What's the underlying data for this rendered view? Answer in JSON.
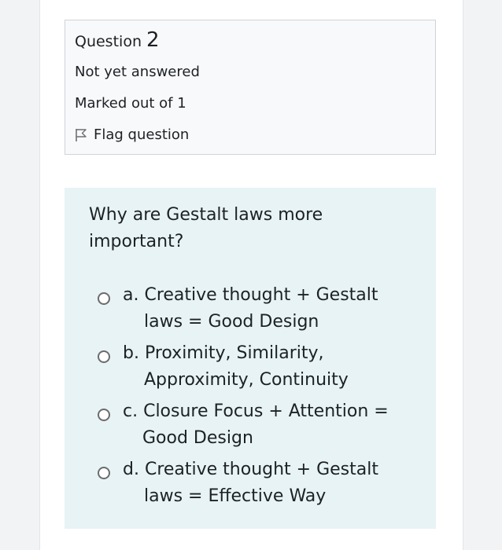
{
  "question_info": {
    "label": "Question",
    "number": "2",
    "state": "Not yet answered",
    "grade": "Marked out of 1",
    "flag_label": "Flag question"
  },
  "question": {
    "text": "Why are Gestalt laws more important?",
    "options": [
      {
        "line1": "a. Creative thought + Gestalt",
        "line2": "laws = Good Design"
      },
      {
        "line1": "b. Proximity, Similarity,",
        "line2": "Approximity, Continuity"
      },
      {
        "line1": "c. Closure Focus + Attention =",
        "line2": "Good Design"
      },
      {
        "line1": "d. Creative thought + Gestalt",
        "line2": "laws = Effective Way"
      }
    ]
  },
  "colors": {
    "info_bg": "#f8f9fa",
    "formulation_bg": "#e7f3f5",
    "gutter": "#f1f3f4",
    "text": "#1d2125"
  }
}
